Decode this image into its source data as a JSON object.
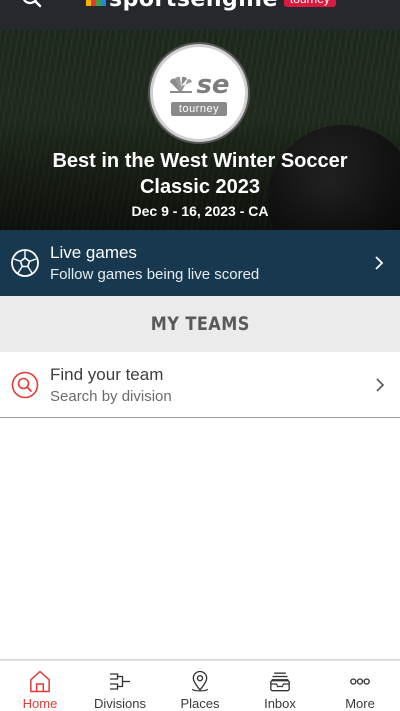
{
  "app": {
    "wordmark": "sportsengine",
    "tag": "tourney"
  },
  "hero": {
    "logo_text": "se",
    "logo_tag": "tourney",
    "title": "Best in the West Winter Soccer Classic 2023",
    "dates": "Dec 9 - 16, 2023 - CA"
  },
  "live": {
    "title": "Live games",
    "subtitle": "Follow games being live scored",
    "icon": "soccer-ball-icon"
  },
  "my_teams": {
    "heading": "MY TEAMS",
    "find_title": "Find your team",
    "find_subtitle": "Search by division",
    "icon": "search-icon"
  },
  "bottom_nav": {
    "items": [
      {
        "label": "Home",
        "icon": "home-icon",
        "active": true
      },
      {
        "label": "Divisions",
        "icon": "bracket-icon",
        "active": false
      },
      {
        "label": "Places",
        "icon": "map-pin-icon",
        "active": false
      },
      {
        "label": "Inbox",
        "icon": "inbox-icon",
        "active": false
      },
      {
        "label": "More",
        "icon": "more-icon",
        "active": false
      }
    ]
  },
  "colors": {
    "accent": "#e53935",
    "live_banner": "#17384e",
    "topbar": "#25292d",
    "tag": "#d81b3f"
  }
}
